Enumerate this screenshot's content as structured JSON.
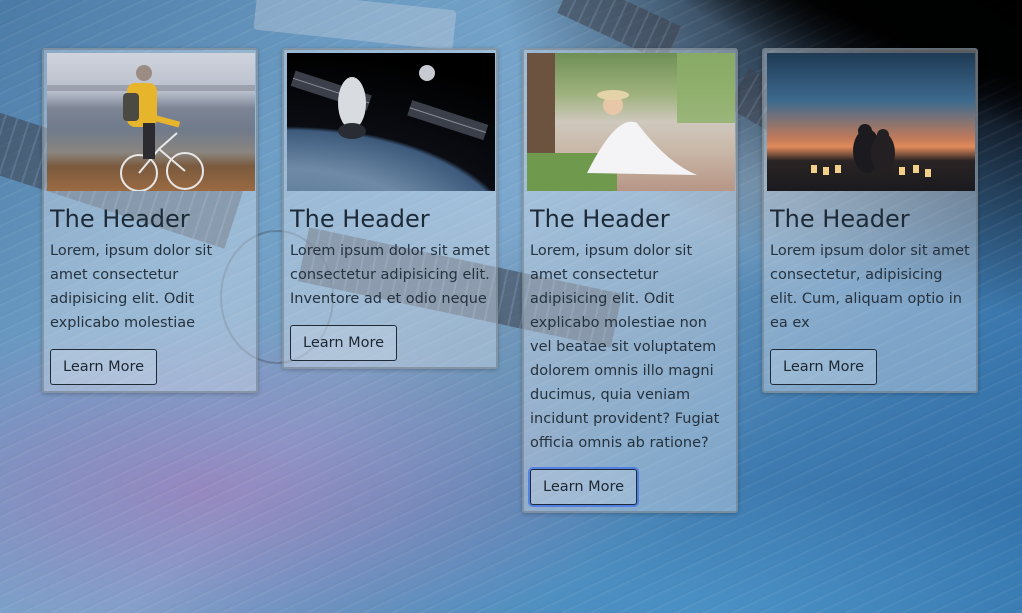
{
  "cards": [
    {
      "image": "cyclist-by-lake",
      "title": "The Header",
      "text": "Lorem, ipsum dolor sit amet consectetur adipisicing elit. Odit explicabo molestiae",
      "button": "Learn More"
    },
    {
      "image": "space-station-over-earth",
      "title": "The Header",
      "text": "Lorem ipsum dolor sit amet consectetur adipisicing elit. Inventore ad et odio neque",
      "button": "Learn More"
    },
    {
      "image": "woman-in-white-dress-sitting",
      "title": "The Header",
      "text": "Lorem, ipsum dolor sit amet consectetur adipisicing elit. Odit explicabo molestiae non vel beatae sit voluptatem dolorem omnis illo magni ducimus, quia veniam incidunt provident? Fugiat officia omnis ab ratione?",
      "button": "Learn More"
    },
    {
      "image": "couple-at-sunset-with-candles",
      "title": "The Header",
      "text": "Lorem ipsum dolor sit amet consectetur, adipisicing elit. Cum, aliquam optio in ea ex",
      "button": "Learn More"
    }
  ],
  "colors": {
    "card_border": "#6e7882",
    "button_border": "#1f2a36",
    "focus_ring": "#4678e6"
  }
}
